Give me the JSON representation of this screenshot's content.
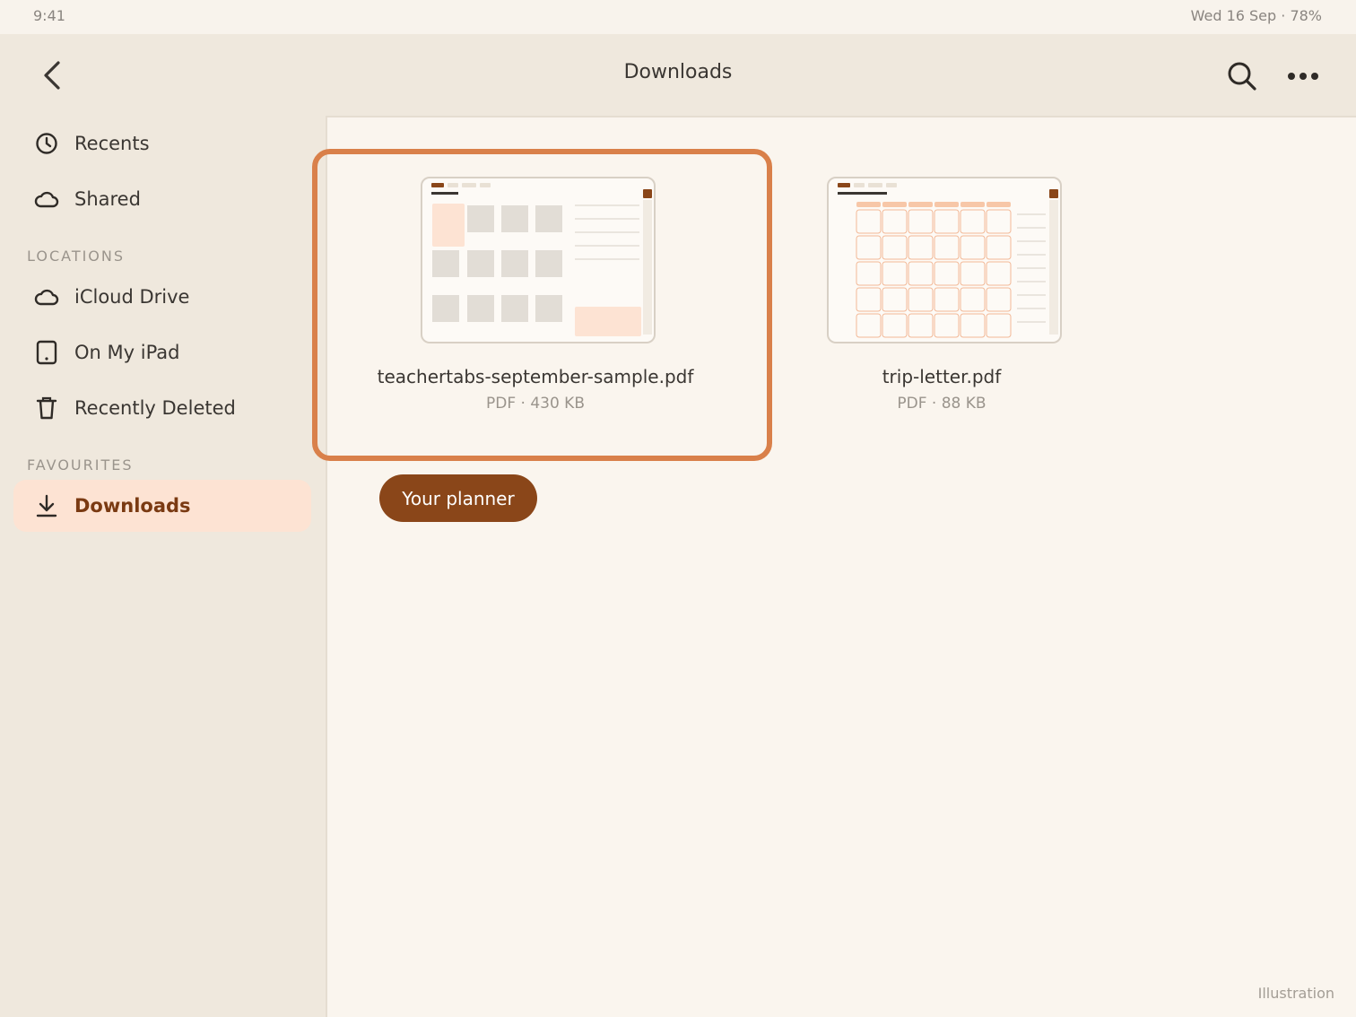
{
  "status_bar": {
    "time": "9:41",
    "right": "Wed 16 Sep · 78%"
  },
  "header": {
    "title": "Downloads"
  },
  "sidebar": {
    "top_items": [
      {
        "label": "Recents",
        "icon": "clock-icon"
      },
      {
        "label": "Shared",
        "icon": "cloud-icon"
      }
    ],
    "locations_heading": "LOCATIONS",
    "locations": [
      {
        "label": "iCloud Drive",
        "icon": "cloud-icon"
      },
      {
        "label": "On My iPad",
        "icon": "ipad-icon"
      },
      {
        "label": "Recently Deleted",
        "icon": "trash-icon"
      }
    ],
    "favourites_heading": "FAVOURITES",
    "favourites": [
      {
        "label": "Downloads",
        "icon": "download-icon",
        "active": true
      }
    ]
  },
  "files": [
    {
      "name": "teachertabs-september-sample.pdf",
      "meta": "PDF · 430 KB",
      "selected": true
    },
    {
      "name": "trip-letter.pdf",
      "meta": "PDF · 88 KB",
      "selected": false
    }
  ],
  "planner_button": "Your planner",
  "caption": "Illustration",
  "colors": {
    "accent": "#d9804a",
    "brand": "#8a4619",
    "active_bg": "#fde3d3"
  }
}
